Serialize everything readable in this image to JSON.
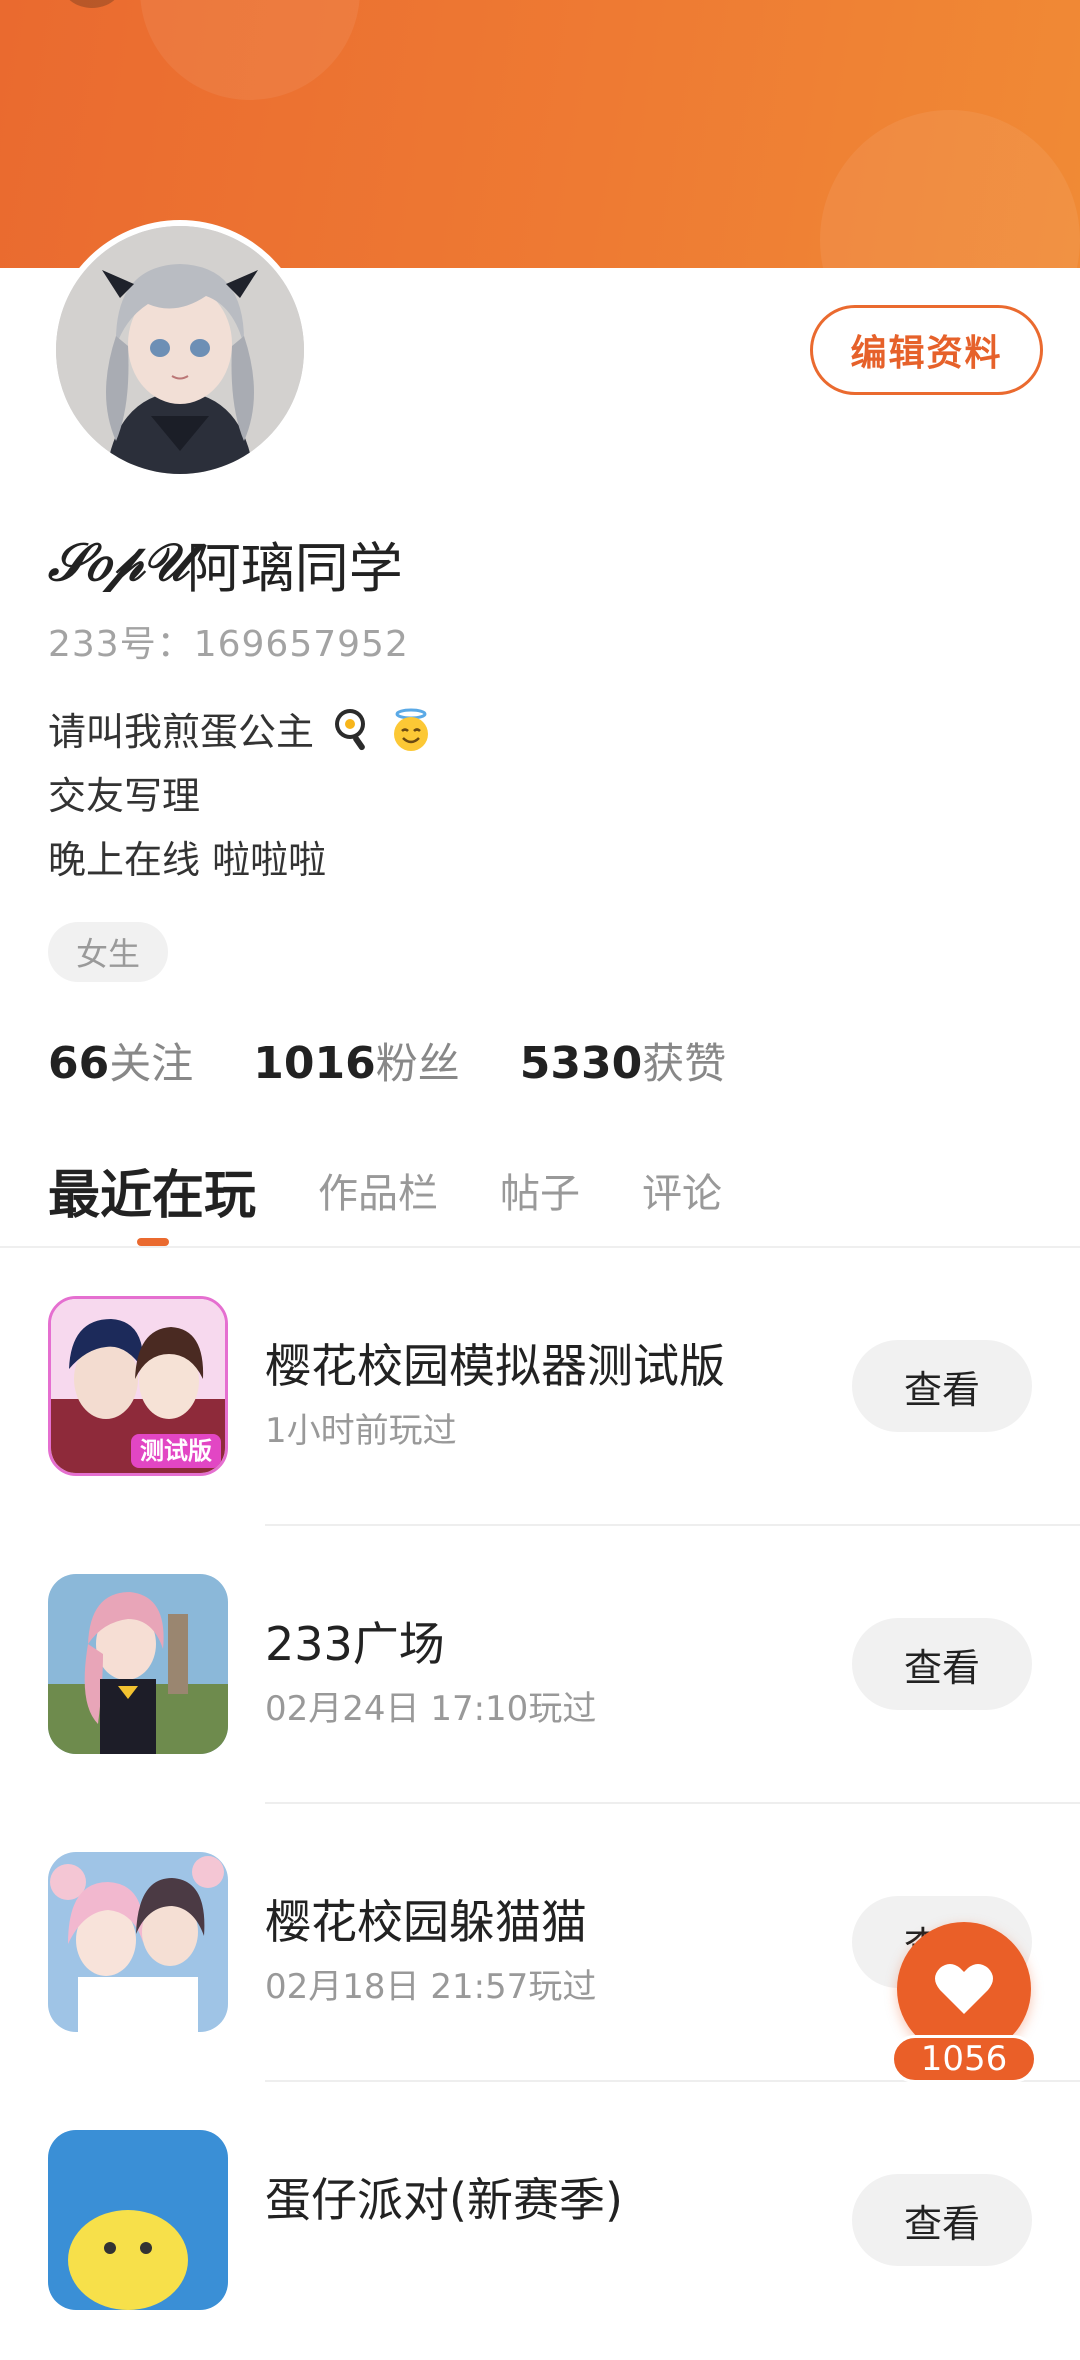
{
  "profile": {
    "name_script": "𝒮𝑜𝓅𝒰",
    "name_text": "阿璃同学",
    "uid_label": "233号：169657952",
    "edit_button": "编辑资料",
    "bio_line1": "请叫我煎蛋公主",
    "bio_line2": "交友写理",
    "bio_line3": "晚上在线   啦啦啦",
    "gender": "女生"
  },
  "stats": {
    "following_count": "66",
    "following_label": "关注",
    "fans_count": "1016",
    "fans_label": "粉丝",
    "likes_count": "5330",
    "likes_label": "获赞"
  },
  "tabs": [
    "最近在玩",
    "作品栏",
    "帖子",
    "评论"
  ],
  "games": [
    {
      "title": "樱花校园模拟器测试版",
      "sub": "1小时前玩过",
      "button": "查看",
      "badge": "测试版"
    },
    {
      "title": "233广场",
      "sub": "02月24日 17:10玩过",
      "button": "查看"
    },
    {
      "title": "樱花校园躲猫猫",
      "sub": "02月18日 21:57玩过",
      "button": "查看"
    },
    {
      "title": "蛋仔派对(新赛季)",
      "sub": "",
      "button": "查看"
    }
  ],
  "like_fab": {
    "count": "1056"
  },
  "colors": {
    "accent": "#ea6a2f",
    "banner": "#ee7a33"
  }
}
